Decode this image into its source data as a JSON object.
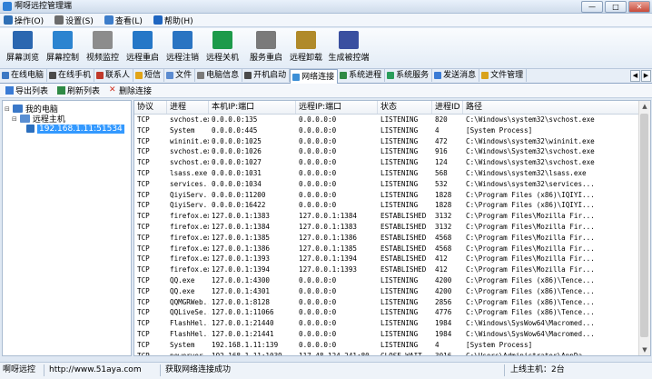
{
  "window": {
    "title": "啊呀远控管理端",
    "buttons": [
      "—",
      "□",
      "✕"
    ]
  },
  "menu": [
    {
      "label": "操作(O)",
      "icon": "operate-icon",
      "color": "#2f6fb5"
    },
    {
      "label": "设置(S)",
      "icon": "settings-icon",
      "color": "#6b6b6b"
    },
    {
      "label": "查看(L)",
      "icon": "view-icon",
      "color": "#3d7dca"
    },
    {
      "label": "帮助(H)",
      "icon": "help-icon",
      "color": "#1f66c1"
    }
  ],
  "toolbar": [
    {
      "label": "屏幕浏览",
      "icon": "monitor-icon",
      "color": "#2b67b0"
    },
    {
      "label": "屏幕控制",
      "icon": "screen-control-icon",
      "color": "#2c84d0"
    },
    {
      "label": "视频监控",
      "icon": "webcam-icon",
      "color": "#8c8c8c"
    },
    {
      "label": "远程重启",
      "icon": "remote-restart-icon",
      "color": "#2577c7"
    },
    {
      "label": "远程注销",
      "icon": "remote-logoff-icon",
      "color": "#2a74c2"
    },
    {
      "label": "远程关机",
      "icon": "remote-shutdown-icon",
      "color": "#1d9a4a"
    },
    {
      "label": "服务重启",
      "icon": "service-restart-icon",
      "color": "#7a7a7a"
    },
    {
      "label": "远程卸载",
      "icon": "remote-uninstall-icon",
      "color": "#b08a2a"
    },
    {
      "label": "生成被控端",
      "icon": "build-client-icon",
      "color": "#3a4fa0"
    }
  ],
  "tabs": [
    {
      "label": "在线电脑",
      "icon": "online-pc-icon",
      "color": "#3b78c4"
    },
    {
      "label": "在线手机",
      "icon": "online-phone-icon",
      "color": "#4a4a4a"
    },
    {
      "label": "联系人",
      "icon": "contacts-icon",
      "color": "#c0392b"
    },
    {
      "label": "短信",
      "icon": "sms-icon",
      "color": "#e2a417"
    },
    {
      "label": "文件",
      "icon": "file-icon",
      "color": "#5b8bd0"
    },
    {
      "label": "电脑信息",
      "icon": "pc-info-icon",
      "color": "#7a7a7a"
    },
    {
      "label": "开机启动",
      "icon": "startup-icon",
      "color": "#4a4a4a"
    },
    {
      "label": "网络连接",
      "icon": "network-icon",
      "color": "#3d8fd6"
    },
    {
      "label": "系统进程",
      "icon": "process-icon",
      "color": "#2f8a45"
    },
    {
      "label": "系统服务",
      "icon": "service-icon",
      "color": "#2a9d5b"
    },
    {
      "label": "发送消息",
      "icon": "message-icon",
      "color": "#3a7bd5"
    },
    {
      "label": "文件管理",
      "icon": "file-manager-icon",
      "color": "#d9a21b"
    }
  ],
  "active_tab_index": 7,
  "subtoolbar": [
    {
      "label": "导出列表",
      "icon": "export-icon",
      "color": "#3a7bd5"
    },
    {
      "label": "刷新列表",
      "icon": "refresh-icon",
      "color": "#2f8a45"
    },
    {
      "label": "删除连接",
      "icon": "delete-icon",
      "color": "#d03020"
    }
  ],
  "tree": {
    "root": "我的电脑",
    "group": "远程主机",
    "host": "192.168.1.11:51534"
  },
  "table": {
    "columns": [
      "协议",
      "进程",
      "本机IP:端口",
      "远程IP:端口",
      "状态",
      "进程ID",
      "路径"
    ],
    "rows": [
      [
        "TCP",
        "svchost.exe",
        "0.0.0.0:135",
        "0.0.0.0:0",
        "LISTENING",
        "820",
        "C:\\Windows\\system32\\svchost.exe"
      ],
      [
        "TCP",
        "System",
        "0.0.0.0:445",
        "0.0.0.0:0",
        "LISTENING",
        "4",
        "[System Process]"
      ],
      [
        "TCP",
        "wininit.exe",
        "0.0.0.0:1025",
        "0.0.0.0:0",
        "LISTENING",
        "472",
        "C:\\Windows\\system32\\wininit.exe"
      ],
      [
        "TCP",
        "svchost.exe",
        "0.0.0.0:1026",
        "0.0.0.0:0",
        "LISTENING",
        "916",
        "C:\\Windows\\System32\\svchost.exe"
      ],
      [
        "TCP",
        "svchost.exe",
        "0.0.0.0:1027",
        "0.0.0.0:0",
        "LISTENING",
        "124",
        "C:\\Windows\\system32\\svchost.exe"
      ],
      [
        "TCP",
        "lsass.exe",
        "0.0.0.0:1031",
        "0.0.0.0:0",
        "LISTENING",
        "568",
        "C:\\Windows\\system32\\lsass.exe"
      ],
      [
        "TCP",
        "services....",
        "0.0.0.0:1034",
        "0.0.0.0:0",
        "LISTENING",
        "532",
        "C:\\Windows\\system32\\services..."
      ],
      [
        "TCP",
        "QiyiServ...",
        "0.0.0.0:11200",
        "0.0.0.0:0",
        "LISTENING",
        "1828",
        "C:\\Program Files (x86)\\IQIYI..."
      ],
      [
        "TCP",
        "QiyiServ...",
        "0.0.0.0:16422",
        "0.0.0.0:0",
        "LISTENING",
        "1828",
        "C:\\Program Files (x86)\\IQIYI..."
      ],
      [
        "TCP",
        "firefox.exe",
        "127.0.0.1:1383",
        "127.0.0.1:1384",
        "ESTABLISHED",
        "3132",
        "C:\\Program Files\\Mozilla Fir..."
      ],
      [
        "TCP",
        "firefox.exe",
        "127.0.0.1:1384",
        "127.0.0.1:1383",
        "ESTABLISHED",
        "3132",
        "C:\\Program Files\\Mozilla Fir..."
      ],
      [
        "TCP",
        "firefox.exe",
        "127.0.0.1:1385",
        "127.0.0.1:1386",
        "ESTABLISHED",
        "4568",
        "C:\\Program Files\\Mozilla Fir..."
      ],
      [
        "TCP",
        "firefox.exe",
        "127.0.0.1:1386",
        "127.0.0.1:1385",
        "ESTABLISHED",
        "4568",
        "C:\\Program Files\\Mozilla Fir..."
      ],
      [
        "TCP",
        "firefox.exe",
        "127.0.0.1:1393",
        "127.0.0.1:1394",
        "ESTABLISHED",
        "412",
        "C:\\Program Files\\Mozilla Fir..."
      ],
      [
        "TCP",
        "firefox.exe",
        "127.0.0.1:1394",
        "127.0.0.1:1393",
        "ESTABLISHED",
        "412",
        "C:\\Program Files\\Mozilla Fir..."
      ],
      [
        "TCP",
        "QQ.exe",
        "127.0.0.1:4300",
        "0.0.0.0:0",
        "LISTENING",
        "4200",
        "C:\\Program Files (x86)\\Tence..."
      ],
      [
        "TCP",
        "QQ.exe",
        "127.0.0.1:4301",
        "0.0.0.0:0",
        "LISTENING",
        "4200",
        "C:\\Program Files (x86)\\Tence..."
      ],
      [
        "TCP",
        "QQMGRWeb...",
        "127.0.0.1:8128",
        "0.0.0.0:0",
        "LISTENING",
        "2856",
        "C:\\Program Files (x86)\\Tence..."
      ],
      [
        "TCP",
        "QQLiveSe...",
        "127.0.0.1:11066",
        "0.0.0.0:0",
        "LISTENING",
        "4776",
        "C:\\Program Files (x86)\\Tence..."
      ],
      [
        "TCP",
        "FlashHel...",
        "127.0.0.1:21440",
        "0.0.0.0:0",
        "LISTENING",
        "1984",
        "C:\\Windows\\SysWow64\\Macromed..."
      ],
      [
        "TCP",
        "FlashHel...",
        "127.0.0.1:21441",
        "0.0.0.0:0",
        "LISTENING",
        "1984",
        "C:\\Windows\\SysWow64\\Macromed..."
      ],
      [
        "TCP",
        "System",
        "192.168.1.11:139",
        "0.0.0.0:0",
        "LISTENING",
        "4",
        "[System Process]"
      ],
      [
        "TCP",
        "powerver...",
        "192.168.1.11:1039",
        "117.48.124.241:80",
        "CLOSE_WAIT",
        "3016",
        "C:\\Users\\Administrator\\AppDa..."
      ]
    ]
  },
  "status": {
    "app": "啊呀远控",
    "website": "http://www.51aya.com",
    "message": "获取网络连接成功",
    "online": "上线主机：2台"
  }
}
